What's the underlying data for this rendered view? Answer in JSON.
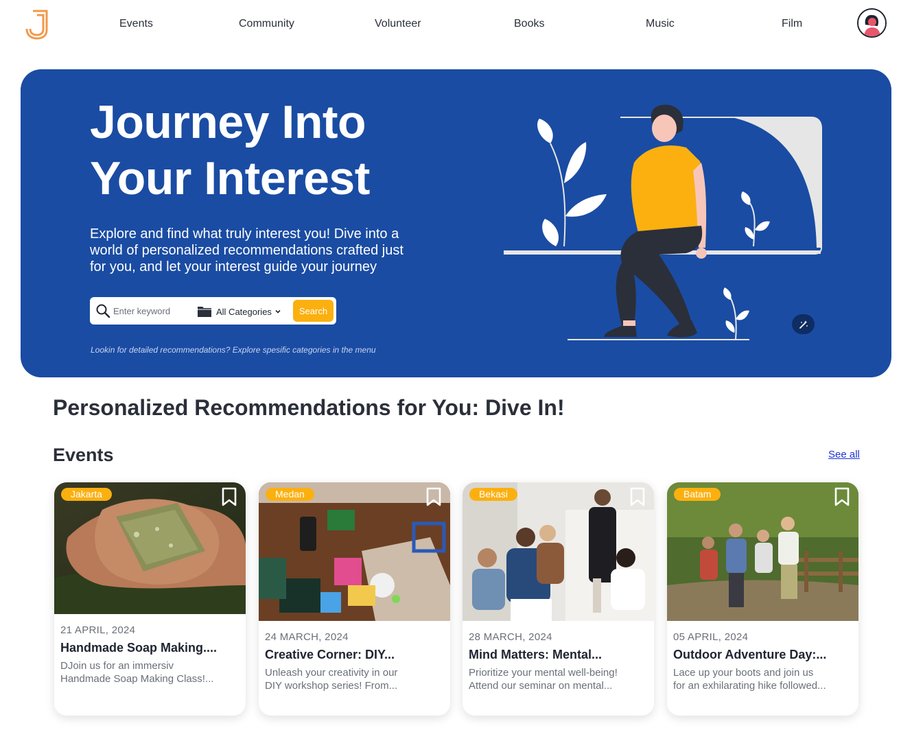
{
  "nav": {
    "items": [
      {
        "label": "Events"
      },
      {
        "label": "Community"
      },
      {
        "label": "Volunteer"
      },
      {
        "label": "Books"
      },
      {
        "label": "Music"
      },
      {
        "label": "Film"
      }
    ]
  },
  "hero": {
    "title_line1": "Journey Into",
    "title_line2": "Your Interest",
    "subtitle": "Explore and find what truly interest you! Dive into a world of personalized recommendations crafted just for you, and let your interest guide your journey",
    "search_placeholder": "Enter keyword",
    "category_label": "All Categories",
    "search_button": "Search",
    "note": "Lookin for detailed recommendations? Explore spesific categories in the menu"
  },
  "main": {
    "section_title": "Personalized Recommendations for You: Dive In!",
    "events_title": "Events",
    "see_all": "See all"
  },
  "events": [
    {
      "city": "Jakarta",
      "date": "21 APRIL, 2024",
      "title": "Handmade Soap Making....",
      "desc_line1": "DJoin us for an immersiv",
      "desc_line2": "Handmade Soap Making Class!..."
    },
    {
      "city": "Medan",
      "date": "24 MARCH, 2024",
      "title": "Creative Corner: DIY...",
      "desc_line1": "Unleash your creativity in our",
      "desc_line2": "DIY workshop series! From..."
    },
    {
      "city": "Bekasi",
      "date": "28 MARCH, 2024",
      "title": "Mind Matters: Mental...",
      "desc_line1": "Prioritize your mental well-being!",
      "desc_line2": "Attend our seminar on mental..."
    },
    {
      "city": "Batam",
      "date": "05 APRIL, 2024",
      "title": "Outdoor Adventure Day:...",
      "desc_line1": "Lace up your boots and join us",
      "desc_line2": "for an exhilarating hike followed..."
    }
  ],
  "colors": {
    "hero_bg": "#1a4ca3",
    "accent": "#fbb010",
    "link": "#1f33d6"
  },
  "icons": [
    "logo-icon",
    "avatar",
    "search-icon",
    "folder-icon",
    "chevron-down-icon",
    "bookmark-icon",
    "magic-wand-icon"
  ]
}
